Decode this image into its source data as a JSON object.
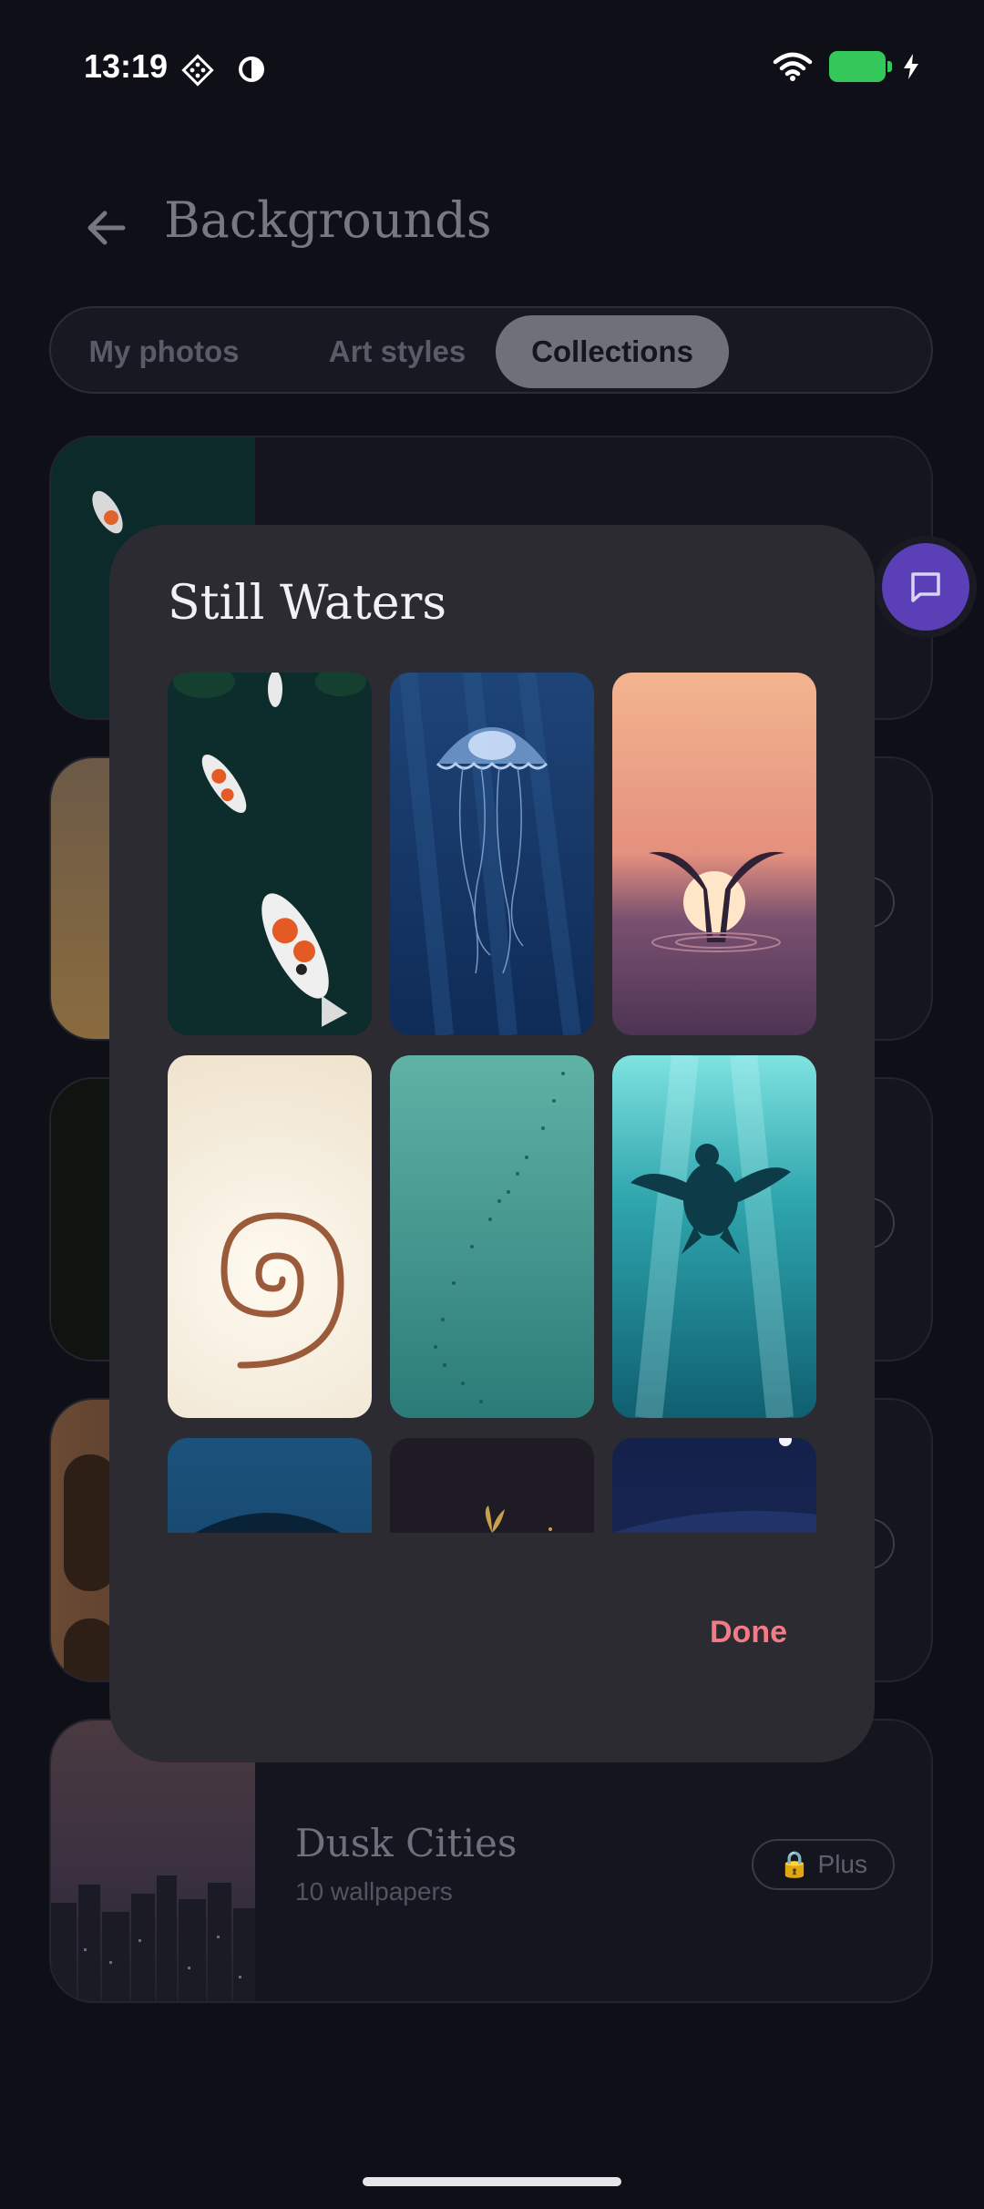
{
  "status_bar": {
    "time": "13:19"
  },
  "header": {
    "title": "Backgrounds"
  },
  "tabs": [
    {
      "label": "My photos"
    },
    {
      "label": "Art styles"
    },
    {
      "label": "Collections",
      "active": true
    }
  ],
  "collections": [
    {
      "name": "",
      "count": "",
      "badge": ""
    },
    {
      "name": "",
      "count": "",
      "badge": ""
    },
    {
      "name": "",
      "count": "",
      "badge": ""
    },
    {
      "name": "",
      "count": "",
      "badge": ""
    },
    {
      "name": "Dusk Cities",
      "count": "10 wallpapers",
      "badge": "🔒 Plus"
    }
  ],
  "dialog": {
    "title": "Still Waters",
    "wallpapers": [
      {
        "name": "koi-pond"
      },
      {
        "name": "jellyfish"
      },
      {
        "name": "whale-tail-sunset"
      },
      {
        "name": "nautilus-shell"
      },
      {
        "name": "fish-school"
      },
      {
        "name": "sea-turtle"
      },
      {
        "name": "whale-deep"
      },
      {
        "name": "night-sprout"
      },
      {
        "name": "night-sea"
      }
    ],
    "done_label": "Done"
  },
  "colors": {
    "accent": "#f47a86",
    "fab": "#5b3fb6",
    "battery": "#34c759"
  },
  "icons": [
    "back-arrow-icon",
    "chat-icon",
    "wifi-icon",
    "battery-icon",
    "lock-icon"
  ]
}
